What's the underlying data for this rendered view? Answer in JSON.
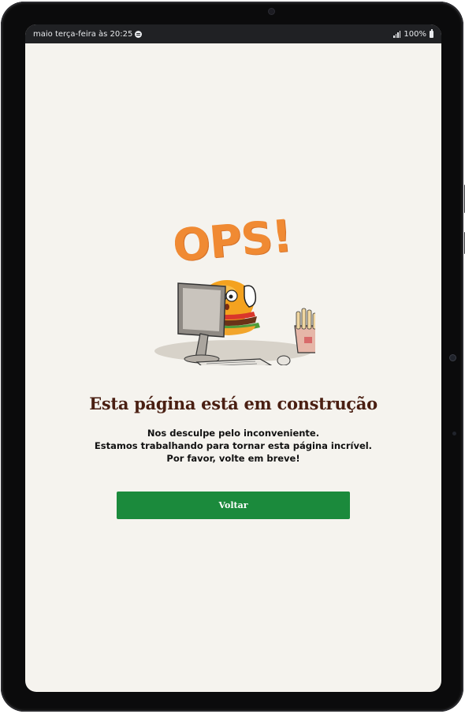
{
  "status_bar": {
    "time_text": "maio terça-feira às 20:25",
    "battery_text": "100%"
  },
  "error_page": {
    "graphic_text": "OPS!",
    "headline": "Esta página está em construção",
    "message_lines": [
      "Nos desculpe pelo inconveniente.",
      "Estamos trabalhando para tornar esta página incrível.",
      "Por favor, volte em breve!"
    ],
    "back_button_label": "Voltar"
  },
  "colors": {
    "background": "#f5f3ee",
    "ops_orange": "#f08a33",
    "headline_brown": "#4a1f12",
    "button_green": "#1b8a3c",
    "status_bar": "#202124"
  },
  "icons": [
    "spotify-icon",
    "signal-icon",
    "battery-icon",
    "burger-at-computer-illustration"
  ]
}
